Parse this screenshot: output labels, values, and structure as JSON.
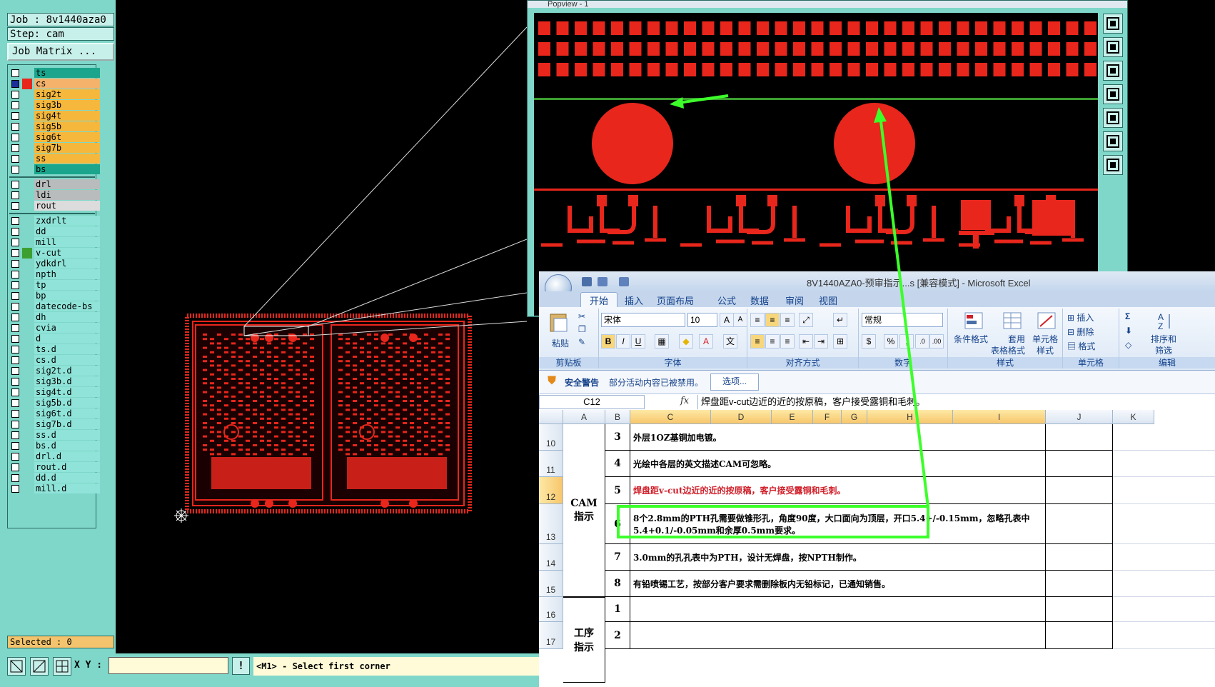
{
  "cam": {
    "job_label": "Job : 8v1440aza0",
    "step_label": "Step: cam",
    "job_matrix_button": "Job Matrix ...",
    "layers_group1": [
      {
        "name": "ts",
        "color": "#1aa58c",
        "checked": false,
        "swatch": ""
      },
      {
        "name": "cs",
        "color": "#f5b26b",
        "checked": true,
        "swatch": "#e8261c"
      },
      {
        "name": "sig2t",
        "color": "#f5b83d",
        "checked": false,
        "swatch": ""
      },
      {
        "name": "sig3b",
        "color": "#f5b83d",
        "checked": false,
        "swatch": ""
      },
      {
        "name": "sig4t",
        "color": "#f5b83d",
        "checked": false,
        "swatch": ""
      },
      {
        "name": "sig5b",
        "color": "#f5b83d",
        "checked": false,
        "swatch": ""
      },
      {
        "name": "sig6t",
        "color": "#f5b83d",
        "checked": false,
        "swatch": ""
      },
      {
        "name": "sig7b",
        "color": "#f5b83d",
        "checked": false,
        "swatch": ""
      },
      {
        "name": "ss",
        "color": "#f5b83d",
        "checked": false,
        "swatch": ""
      },
      {
        "name": "bs",
        "color": "#1aa58c",
        "checked": false,
        "swatch": ""
      }
    ],
    "layers_group2": [
      {
        "name": "drl",
        "color": "#b9bcbc",
        "checked": false,
        "swatch": ""
      },
      {
        "name": "ldi",
        "color": "#b9bcbc",
        "checked": false,
        "swatch": ""
      },
      {
        "name": "rout",
        "color": "#dcdcdc",
        "checked": false,
        "swatch": ""
      }
    ],
    "layers_group3": [
      {
        "name": "zxdrlt",
        "color": "#8fe3d8",
        "checked": false,
        "swatch": ""
      },
      {
        "name": "dd",
        "color": "#8fe3d8",
        "checked": false,
        "swatch": ""
      },
      {
        "name": "mill",
        "color": "#8fe3d8",
        "checked": false,
        "swatch": ""
      },
      {
        "name": "v-cut",
        "color": "#8fe3d8",
        "checked": false,
        "swatch": "#3ca030"
      },
      {
        "name": "ydkdrl",
        "color": "#8fe3d8",
        "checked": false,
        "swatch": ""
      },
      {
        "name": "npth",
        "color": "#8fe3d8",
        "checked": false,
        "swatch": ""
      },
      {
        "name": "tp",
        "color": "#8fe3d8",
        "checked": false,
        "swatch": ""
      },
      {
        "name": "bp",
        "color": "#8fe3d8",
        "checked": false,
        "swatch": ""
      },
      {
        "name": "datecode-bs",
        "color": "#8fe3d8",
        "checked": false,
        "swatch": ""
      },
      {
        "name": "dh",
        "color": "#8fe3d8",
        "checked": false,
        "swatch": ""
      },
      {
        "name": "cvia",
        "color": "#8fe3d8",
        "checked": false,
        "swatch": ""
      },
      {
        "name": "d",
        "color": "#8fe3d8",
        "checked": false,
        "swatch": ""
      },
      {
        "name": "ts.d",
        "color": "#8fe3d8",
        "checked": false,
        "swatch": ""
      },
      {
        "name": "cs.d",
        "color": "#8fe3d8",
        "checked": false,
        "swatch": ""
      },
      {
        "name": "sig2t.d",
        "color": "#8fe3d8",
        "checked": false,
        "swatch": ""
      },
      {
        "name": "sig3b.d",
        "color": "#8fe3d8",
        "checked": false,
        "swatch": ""
      },
      {
        "name": "sig4t.d",
        "color": "#8fe3d8",
        "checked": false,
        "swatch": ""
      },
      {
        "name": "sig5b.d",
        "color": "#8fe3d8",
        "checked": false,
        "swatch": ""
      },
      {
        "name": "sig6t.d",
        "color": "#8fe3d8",
        "checked": false,
        "swatch": ""
      },
      {
        "name": "sig7b.d",
        "color": "#8fe3d8",
        "checked": false,
        "swatch": ""
      },
      {
        "name": "ss.d",
        "color": "#8fe3d8",
        "checked": false,
        "swatch": ""
      },
      {
        "name": "bs.d",
        "color": "#8fe3d8",
        "checked": false,
        "swatch": ""
      },
      {
        "name": "drl.d",
        "color": "#8fe3d8",
        "checked": false,
        "swatch": ""
      },
      {
        "name": "rout.d",
        "color": "#8fe3d8",
        "checked": false,
        "swatch": ""
      },
      {
        "name": "dd.d",
        "color": "#8fe3d8",
        "checked": false,
        "swatch": ""
      },
      {
        "name": "mill.d",
        "color": "#8fe3d8",
        "checked": false,
        "swatch": ""
      }
    ],
    "selected_label": "Selected : 0",
    "xy_label": "X Y :",
    "xy_value": "",
    "warn_button": "!",
    "status_message": "<M1> - Select first corner",
    "board_color": "#e8261c"
  },
  "popview": {
    "title": "Popview - 1",
    "tools": [
      "zoom-fit-icon",
      "zoom-up-icon",
      "zoom-down-icon",
      "pan-left-icon",
      "pan-right-icon",
      "zoom-in-icon",
      "zoom-out-icon"
    ]
  },
  "excel": {
    "title": "8V1440AZA0-预审指示...s  [兼容模式] - Microsoft Excel",
    "tabs": [
      "开始",
      "插入",
      "页面布局",
      "公式",
      "数据",
      "审阅",
      "视图"
    ],
    "ribbon": {
      "paste": "粘贴",
      "clipboard_group": "剪贴板",
      "font_name": "宋体",
      "font_size": "10",
      "font_group": "字体",
      "align_group": "对齐方式",
      "number_format": "常规",
      "number_group": "数字",
      "cond_format": "条件格式",
      "table_format_1": "套用",
      "table_format_2": "表格格式",
      "cell_style_1": "单元格",
      "cell_style_2": "样式",
      "style_group": "样式",
      "insert": "插入",
      "delete": "删除",
      "format": "格式",
      "cells_group": "单元格",
      "sort_1": "排序和",
      "sort_2": "筛选",
      "edit_group": "编辑"
    },
    "security": {
      "title": "安全警告",
      "message": "部分活动内容已被禁用。",
      "button": "选项..."
    },
    "namebox": "C12",
    "formula": "焊盘距v-cut边近的近的按原稿，客户接受露铜和毛刺。",
    "columns": [
      "A",
      "B",
      "C",
      "D",
      "E",
      "F",
      "G",
      "H",
      "I",
      "J",
      "K"
    ],
    "rows": [
      {
        "row": "10",
        "num": "3",
        "text": "外层1OZ基铜加电镀。"
      },
      {
        "row": "11",
        "num": "4",
        "text": "光绘中各层的英文描述CAM可忽略。"
      },
      {
        "row": "12",
        "num": "5",
        "text": "焊盘距v-cut边近的近的按原稿，客户接受露铜和毛刺。"
      },
      {
        "row": "13",
        "num": "6",
        "text": "8个2.8mm的PTH孔需要做锥形孔，角度90度，大口面向为顶层，开口5.4+/-0.15mm，忽略孔表中5.4+0.1/-0.05mm和余厚0.5mm要求。"
      },
      {
        "row": "14",
        "num": "7",
        "text": "3.0mm的孔孔表中为PTH，设计无焊盘，按NPTH制作。"
      },
      {
        "row": "15",
        "num": "8",
        "text": "有铅喷锡工艺，按部分客户要求需删除板内无铅标记，已通知销售。"
      },
      {
        "row": "16",
        "num": "1",
        "text": ""
      },
      {
        "row": "17",
        "num": "2",
        "text": ""
      }
    ],
    "group_cam": "CAM\n指示",
    "group_process": "工序\n指示",
    "highlight_color": "#d0202a",
    "annotation_color": "#3cff2a"
  }
}
